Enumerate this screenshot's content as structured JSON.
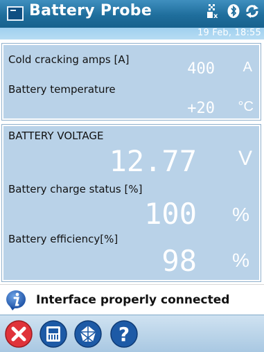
{
  "app": {
    "title": "Battery Probe",
    "datetime": "19 Feb, 18:55"
  },
  "status_icons": [
    "connectivity-x-icon",
    "bluetooth-icon",
    "sync-arrows-icon"
  ],
  "panel_top": {
    "rows": [
      {
        "label": "Cold cracking amps [A]",
        "value": "400",
        "unit": "A"
      },
      {
        "label": "Battery temperature",
        "value": "+20",
        "unit": "°C"
      }
    ]
  },
  "panel_main": {
    "heading": "BATTERY VOLTAGE",
    "voltage": {
      "value": "12.77",
      "unit": "V"
    },
    "charge": {
      "label": "Battery charge status [%]",
      "value": "100",
      "unit": "%"
    },
    "efficiency": {
      "label": "Battery efficiency[%]",
      "value": "98",
      "unit": "%"
    }
  },
  "status": {
    "message": "Interface properly connected"
  },
  "toolbar": {
    "buttons": [
      "close-icon",
      "battery-module-icon",
      "network-icon",
      "help-icon"
    ]
  },
  "colors": {
    "titlebar": "#1f6e9c",
    "panel": "#b9d2e8",
    "close": "#e0333a",
    "button": "#1d5aa6"
  }
}
